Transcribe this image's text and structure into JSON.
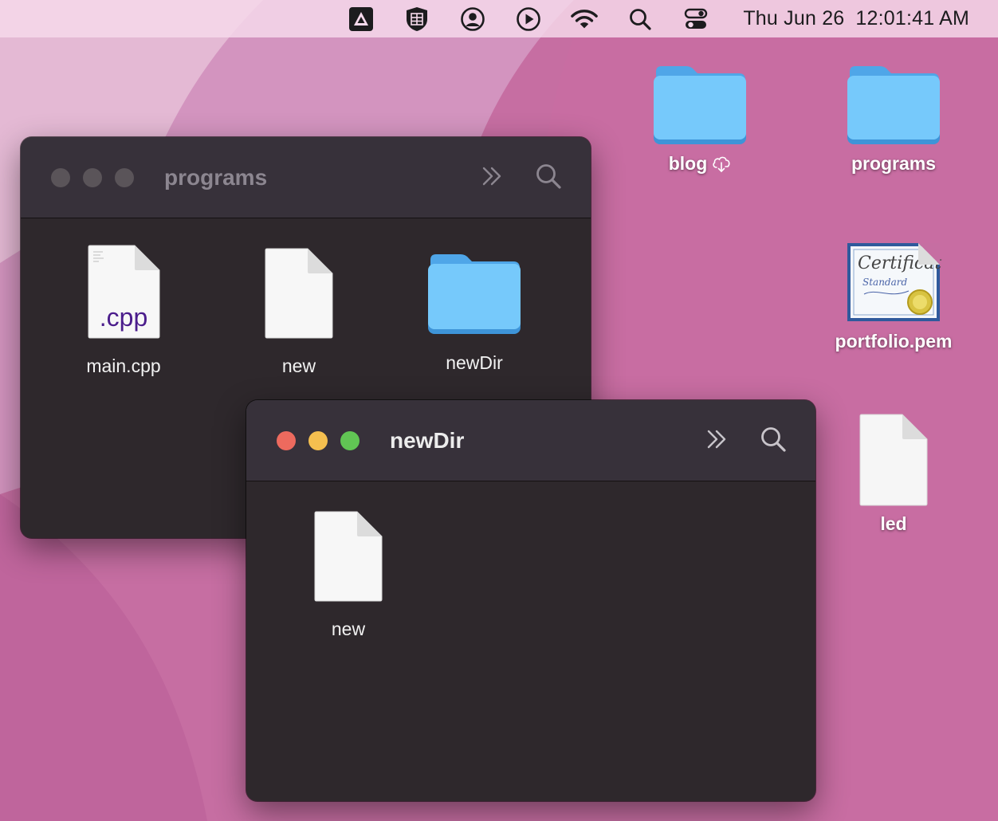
{
  "menubar": {
    "icons": [
      "arc-browser-icon",
      "vpn-shield-icon",
      "user-account-icon",
      "media-play-icon",
      "wifi-icon",
      "spotlight-search-icon",
      "control-center-icon"
    ],
    "date": "Thu Jun 26",
    "time": "12:01:41 AM"
  },
  "desktop": {
    "items": [
      {
        "label": "blog",
        "kind": "folder",
        "badge": "icloud-download-icon"
      },
      {
        "label": "programs",
        "kind": "folder"
      },
      {
        "label": "portfolio.pem",
        "kind": "certificate",
        "cert_lines": [
          "Certificate",
          "Standard"
        ]
      },
      {
        "label": "led",
        "kind": "document"
      }
    ]
  },
  "windows": {
    "programs": {
      "title": "programs",
      "state": "inactive",
      "items": [
        {
          "label": "main.cpp",
          "kind": "cpp-source",
          "badge": ".cpp"
        },
        {
          "label": "new",
          "kind": "document"
        },
        {
          "label": "newDir",
          "kind": "folder"
        }
      ]
    },
    "newDir": {
      "title": "newDir",
      "state": "active",
      "items": [
        {
          "label": "new",
          "kind": "document"
        }
      ]
    }
  },
  "colors": {
    "wallpaper": "#c86fa3",
    "window_bg": "#2e282c",
    "titlebar": "#37313a",
    "close": "#ed6a5e",
    "minimize": "#f5bf4f",
    "zoom": "#61c554",
    "folder": "#6cc2f6",
    "cpp_badge": "#4b1d8c"
  }
}
